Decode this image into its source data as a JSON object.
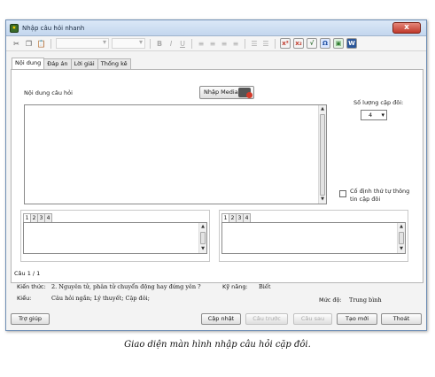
{
  "window": {
    "title": "Nhập câu hỏi nhanh",
    "close_label": "x"
  },
  "toolbar": {
    "bold": "B",
    "italic": "I",
    "underline": "U"
  },
  "tabs": [
    {
      "label": "Nội dung"
    },
    {
      "label": "Đáp án"
    },
    {
      "label": "Lời giải"
    },
    {
      "label": "Thống kê"
    }
  ],
  "content": {
    "question_label": "Nội dung câu hỏi",
    "media_button": "Nhập Media",
    "pair_count_label": "Số lượng cặp đôi:",
    "pair_count_value": "4",
    "fix_order_label_1": "Cố định thứ tự thông",
    "fix_order_label_2": "tin cặp đôi",
    "left_tabs": [
      "1",
      "2",
      "3",
      "4"
    ],
    "right_tabs": [
      "1",
      "2",
      "3",
      "4"
    ]
  },
  "info": {
    "question_no": "Câu 1 / 1",
    "knowledge_label": "Kiến thức:",
    "knowledge_value": "2. Nguyên tử, phân tử chuyển động hay đứng yên ?",
    "skill_label": "Kỹ năng:",
    "skill_value": "Biết",
    "type_label": "Kiểu:",
    "type_value": "Câu hỏi ngắn; Lý thuyết; Cặp đôi;",
    "level_label": "Mức độ:",
    "level_value": "Trung bình"
  },
  "buttons": {
    "help": "Trợ giúp",
    "update": "Cập nhật",
    "prev": "Câu trước",
    "next": "Câu sau",
    "new": "Tạo mới",
    "exit": "Thoát"
  },
  "caption": "Giao diện màn hình nhập câu hỏi cặp đôi."
}
